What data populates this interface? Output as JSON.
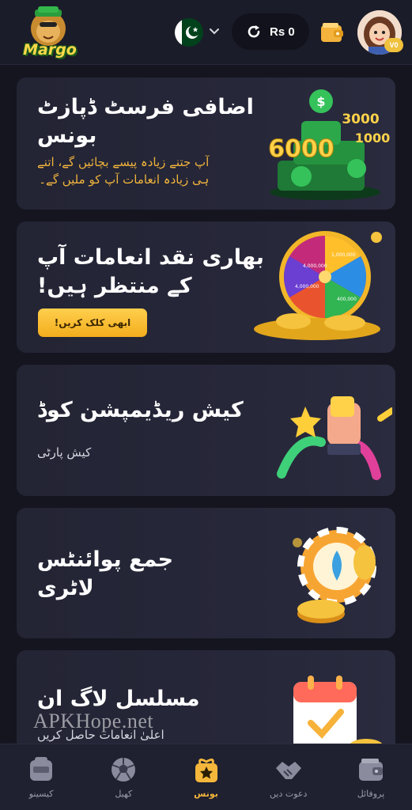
{
  "header": {
    "logo_text": "Margo",
    "country": "Pakistan",
    "balance": "Rs 0",
    "vip_badge": "V0",
    "icons": [
      "margo-logo",
      "pakistan-flag-icon",
      "chevron-down-icon",
      "refresh-icon",
      "wallet-icon",
      "avatar"
    ]
  },
  "cards": [
    {
      "title_line1": "اضافی فرسٹ ڈپازٹ",
      "title_line2": "بونس",
      "subtitle_line1": "آپ جتنے زیادہ پیسے بچائیں گے، اتنے",
      "subtitle_line2": "ہی زیادہ انعامات آپ کو ملیں گے۔",
      "subtitle_color": "#f0b33c",
      "art_numbers": [
        "6000",
        "3000",
        "1000"
      ]
    },
    {
      "title_line1": "بھاری نقد انعامات آپ",
      "title_line2": "کے منتظر ہیں!",
      "button_label": "ابھی کلک کریں!",
      "art_labels": [
        "4,000,000",
        "1,000,000",
        "4,000,000",
        "400,000"
      ]
    },
    {
      "title_line1": "کیش ریڈیمپشن کوڈ",
      "subtitle_line1": "کیش پارٹی"
    },
    {
      "title_line1": "جمع پوائنٹس",
      "title_line2": "لاٹری"
    },
    {
      "title_line1": "مسلسل لاگ ان",
      "subtitle_line1": "اعلیٰ انعامات حاصل کریں"
    }
  ],
  "watermark": "APKHope.net",
  "bottom_nav": [
    {
      "label": "کیسینو",
      "icon": "casino-icon",
      "active": false
    },
    {
      "label": "کھیل",
      "icon": "football-icon",
      "active": false
    },
    {
      "label": "بونس",
      "icon": "bonus-gift-icon",
      "active": true
    },
    {
      "label": "دعوت دیں",
      "icon": "handshake-icon",
      "active": false
    },
    {
      "label": "پروفائل",
      "icon": "wallet-profile-icon",
      "active": false
    }
  ],
  "colors": {
    "background": "#14151f",
    "card": "#252637",
    "accent": "#f4b73b",
    "header": "#1b1c29"
  }
}
